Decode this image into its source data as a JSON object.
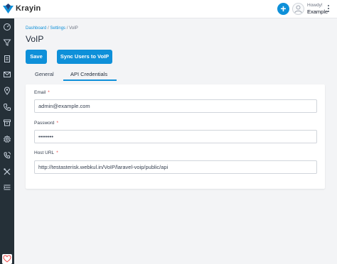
{
  "header": {
    "brand": "Krayin",
    "add_label": "+",
    "greeting": "Howdy!",
    "user_name": "Example"
  },
  "sidebar": {
    "items": [
      {
        "icon": "dashboard-icon"
      },
      {
        "icon": "filter-icon"
      },
      {
        "icon": "document-icon"
      },
      {
        "icon": "mail-icon"
      },
      {
        "icon": "location-icon"
      },
      {
        "icon": "phone-icon"
      },
      {
        "icon": "archive-icon"
      },
      {
        "icon": "settings-icon"
      },
      {
        "icon": "voip-phone-icon"
      },
      {
        "icon": "tools-icon"
      },
      {
        "icon": "menu-collapse-icon"
      }
    ]
  },
  "breadcrumb": {
    "items": [
      "Dashboard",
      "Settings",
      "VoIP"
    ],
    "separator": "/"
  },
  "page": {
    "title": "VoIP"
  },
  "actions": {
    "save_label": "Save",
    "sync_label": "Sync Users to VoIP"
  },
  "tabs": [
    {
      "label": "General",
      "active": false
    },
    {
      "label": "API Credentials",
      "active": true
    }
  ],
  "form": {
    "email": {
      "label": "Email",
      "required": "*",
      "value": "admin@example.com"
    },
    "password": {
      "label": "Password",
      "required": "*",
      "value": "••••••••"
    },
    "host_url": {
      "label": "Host URL",
      "required": "*",
      "value": "http://testasterisk.webkul.in/VoIP/laravel-voip/public/api"
    }
  },
  "colors": {
    "accent": "#0e90d9",
    "sidebar": "#253038",
    "required": "#ef4444"
  }
}
